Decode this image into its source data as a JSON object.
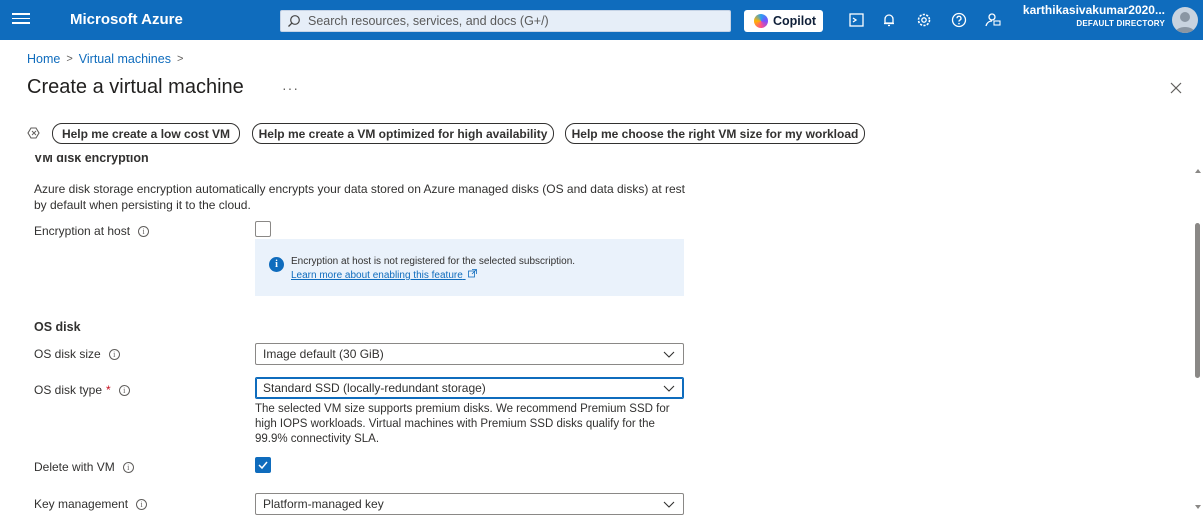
{
  "topbar": {
    "brand": "Microsoft Azure",
    "search_placeholder": "Search resources, services, and docs (G+/)",
    "copilot_label": "Copilot",
    "username": "karthikasivakumar2020...",
    "directory": "DEFAULT DIRECTORY",
    "icons": [
      "menu-icon",
      "search-icon",
      "cloud-shell-icon",
      "notifications-icon",
      "settings-icon",
      "help-icon",
      "feedback-icon",
      "avatar"
    ]
  },
  "breadcrumb": {
    "items": [
      "Home",
      "Virtual machines"
    ]
  },
  "page": {
    "title": "Create a virtual machine",
    "more": "···"
  },
  "copilot_prompts": [
    "Help me create a low cost VM",
    "Help me create a VM optimized for high availability",
    "Help me choose the right VM size for my workload"
  ],
  "disk_encryption": {
    "heading": "VM disk encryption",
    "description": "Azure disk storage encryption automatically encrypts your data stored on Azure managed disks (OS and data disks) at rest by default when persisting it to the cloud.",
    "encryption_at_host_label": "Encryption at host",
    "encryption_at_host_checked": false,
    "info_message": "Encryption at host is not registered for the selected subscription.",
    "info_link": "Learn more about enabling this feature"
  },
  "os_disk": {
    "heading": "OS disk",
    "size_label": "OS disk size",
    "size_value": "Image default (30 GiB)",
    "type_label": "OS disk type",
    "required_mark": "*",
    "type_value": "Standard SSD (locally-redundant storage)",
    "type_help": "The selected VM size supports premium disks. We recommend Premium SSD for high IOPS workloads. Virtual machines with Premium SSD disks qualify for the 99.9% connectivity SLA.",
    "delete_label": "Delete with VM",
    "delete_checked": true,
    "key_mgmt_label": "Key management",
    "key_mgmt_value": "Platform-managed key"
  },
  "colors": {
    "accent": "#0f6cbd",
    "required": "#c50f1f",
    "info_bg": "#eaf2fb"
  }
}
